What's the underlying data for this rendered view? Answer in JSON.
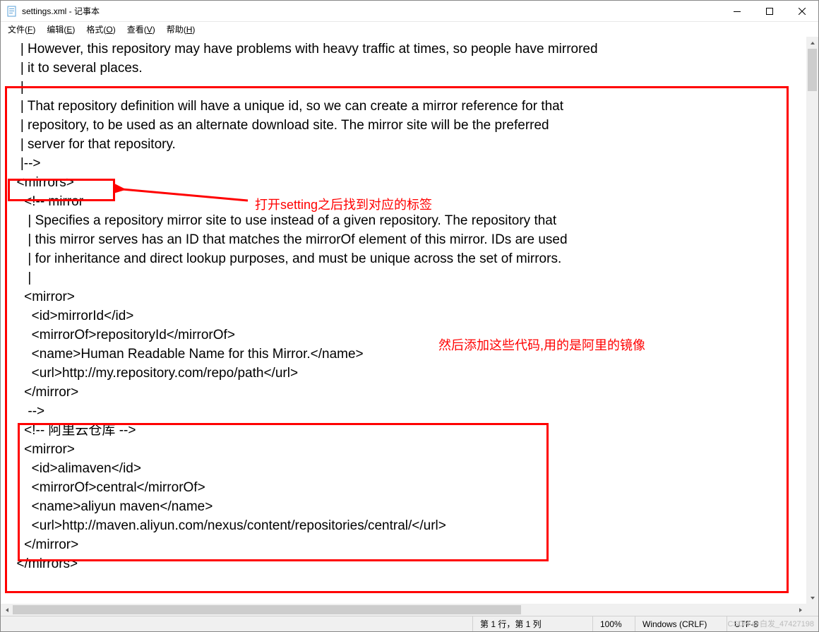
{
  "window": {
    "title": "settings.xml - 记事本"
  },
  "menu": {
    "file": "文件(F)",
    "edit": "编辑(E)",
    "format": "格式(O)",
    "view": "查看(V)",
    "help": "帮助(H)"
  },
  "editor": {
    "lines": [
      "   | However, this repository may have problems with heavy traffic at times, so people have mirrored",
      "   | it to several places.",
      "   |",
      "   | That repository definition will have a unique id, so we can create a mirror reference for that",
      "   | repository, to be used as an alternate download site. The mirror site will be the preferred",
      "   | server for that repository.",
      "   |-->",
      "  <mirrors>",
      "    <!-- mirror",
      "     | Specifies a repository mirror site to use instead of a given repository. The repository that",
      "     | this mirror serves has an ID that matches the mirrorOf element of this mirror. IDs are used",
      "     | for inheritance and direct lookup purposes, and must be unique across the set of mirrors.",
      "     |",
      "    <mirror>",
      "      <id>mirrorId</id>",
      "      <mirrorOf>repositoryId</mirrorOf>",
      "      <name>Human Readable Name for this Mirror.</name>",
      "      <url>http://my.repository.com/repo/path</url>",
      "    </mirror>",
      "     -->",
      "    <!-- 阿里云仓库 -->",
      "    <mirror>",
      "      <id>alimaven</id>",
      "      <mirrorOf>central</mirrorOf>",
      "      <name>aliyun maven</name>",
      "      <url>http://maven.aliyun.com/nexus/content/repositories/central/</url>",
      "    </mirror>",
      "  </mirrors>"
    ]
  },
  "status": {
    "position": "第 1 行，第 1 列",
    "zoom": "100%",
    "line_ending": "Windows (CRLF)",
    "encoding": "UTF-8"
  },
  "annotations": {
    "label1": "打开setting之后找到对应的标签",
    "label2": "然后添加这些代码,用的是阿里的镜像"
  },
  "watermark": "CSDN @白发_47427198"
}
